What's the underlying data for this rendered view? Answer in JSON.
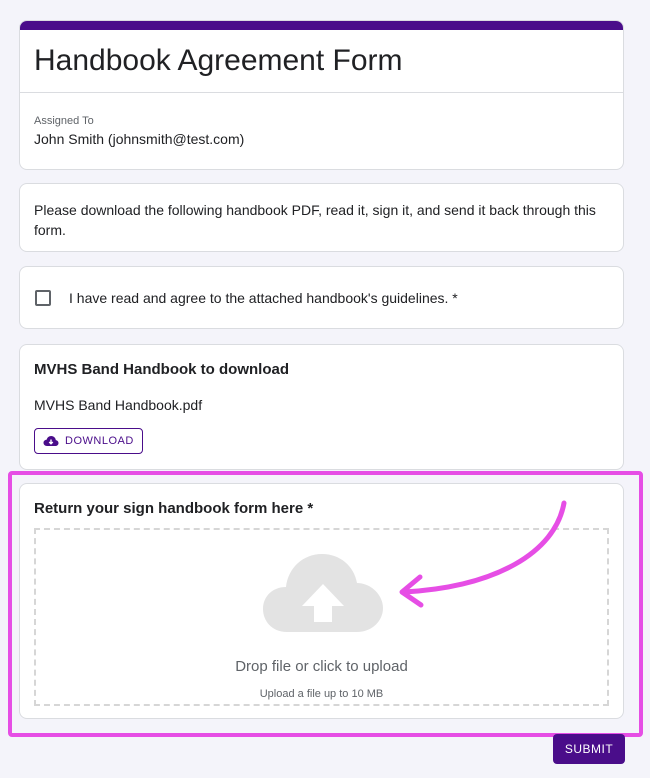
{
  "form": {
    "title": "Handbook Agreement Form",
    "assigned_label": "Assigned To",
    "assigned_value": "John Smith (johnsmith@test.com)",
    "instructions": "Please download the following handbook PDF, read it, sign it, and send it back through this form.",
    "agreement_label": "I have read and agree to the attached handbook's guidelines. *",
    "agreement_checked": false
  },
  "download": {
    "heading": "MVHS Band Handbook to download",
    "file_name": "MVHS Band Handbook.pdf",
    "button_label": "DOWNLOAD",
    "button_icon": "cloud-download-icon"
  },
  "upload": {
    "heading": "Return your sign handbook form here *",
    "drop_text": "Drop file or click to upload",
    "hint": "Upload a file up to 10 MB",
    "icon": "cloud-upload-icon"
  },
  "actions": {
    "submit_label": "SUBMIT"
  },
  "colors": {
    "accent": "#4a0d8a",
    "highlight": "#e64ee5",
    "background": "#f4f4fa"
  }
}
